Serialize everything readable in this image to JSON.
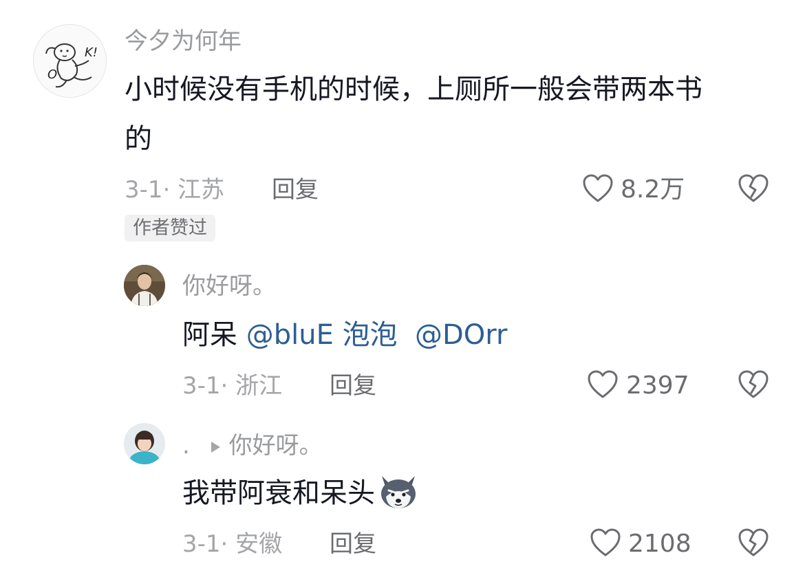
{
  "comments": [
    {
      "username": "今夕为何年",
      "text": "小时候没有手机的时候，上厕所一般会带两本书的",
      "text_line1": "小时候没有手机的时候，上厕所一般会带两本书",
      "text_line2": "的",
      "meta": "3-1· 江苏",
      "reply_label": "回复",
      "likes": "8.2万",
      "badge": "作者赞过",
      "replies": [
        {
          "username": "你好呀。",
          "text_prefix": "阿呆 ",
          "mentions": [
            "@bluE 泡泡",
            "@DOrr"
          ],
          "meta": "3-1· 浙江",
          "reply_label": "回复",
          "likes": "2397"
        },
        {
          "username_prefix": ".",
          "reply_to": "你好呀。",
          "text": "我带阿衰和呆头",
          "emoji": "husky-emoji",
          "meta": "3-1· 安徽",
          "reply_label": "回复",
          "likes": "2108"
        }
      ]
    }
  ],
  "colors": {
    "username": "#9a9b9e",
    "text": "#161823",
    "meta": "#a4a5a8",
    "mention": "#2c5e93",
    "badge_bg": "#f1f1f2"
  }
}
